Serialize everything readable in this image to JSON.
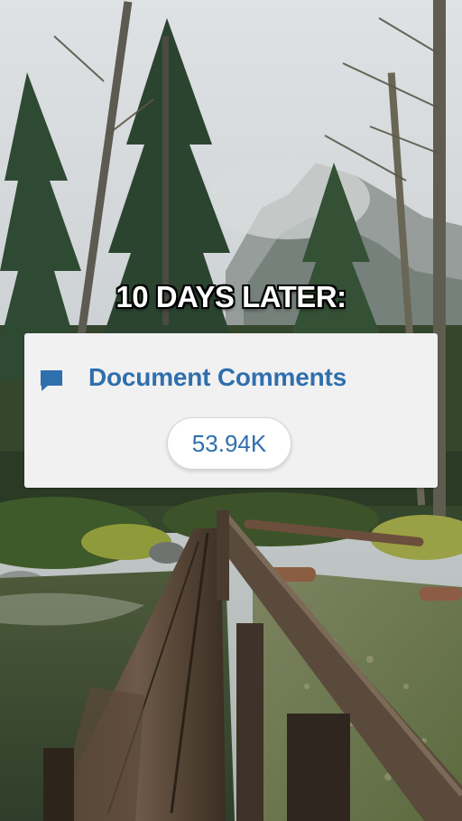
{
  "overlay_caption": "10 DAYS LATER:",
  "stats_card": {
    "icon": "comment-icon",
    "title": "Document Comments",
    "count": "53.94K"
  },
  "colors": {
    "accent_blue": "#2f6fad",
    "card_background": "#f1f1f1",
    "caption_text": "#ffffff",
    "caption_outline": "#000000"
  },
  "background_photo": {
    "subject": "old wooden footbridge over a forest creek, tall evergreen trees and misty cliffs",
    "icon": "photo-icon"
  }
}
